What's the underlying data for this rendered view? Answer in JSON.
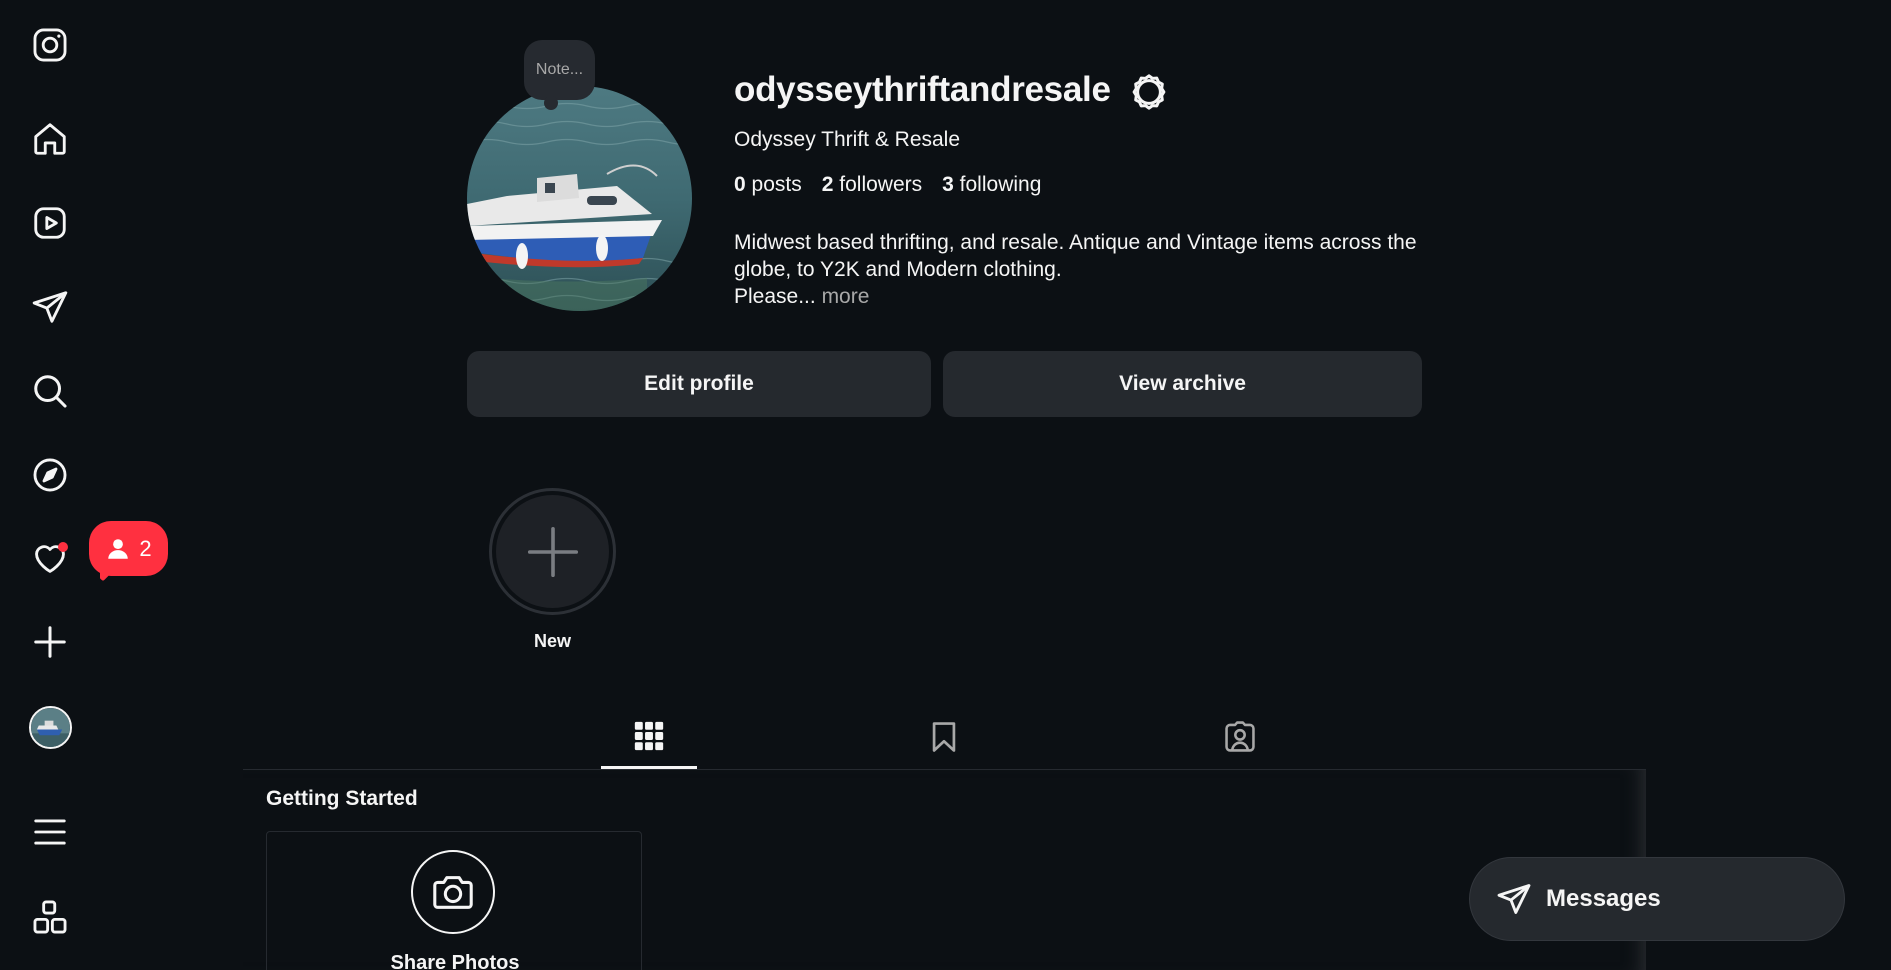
{
  "sidebar": {
    "items": [
      {
        "name": "instagram-logo-icon"
      },
      {
        "name": "home-icon"
      },
      {
        "name": "reels-icon"
      },
      {
        "name": "direct-messages-icon"
      },
      {
        "name": "search-icon"
      },
      {
        "name": "explore-compass-icon"
      },
      {
        "name": "notifications-heart-icon"
      },
      {
        "name": "create-plus-icon"
      },
      {
        "name": "profile-avatar"
      },
      {
        "name": "menu-hamburger-icon"
      },
      {
        "name": "also-from-meta-icon"
      }
    ],
    "notification_badge_count": "2"
  },
  "profile": {
    "note_text": "Note...",
    "username": "odysseythriftandresale",
    "full_name": "Odyssey Thrift & Resale",
    "stats": {
      "posts_count": "0",
      "posts_label": "posts",
      "followers_count": "2",
      "followers_label": "followers",
      "following_count": "3",
      "following_label": "following"
    },
    "bio_line1": "Midwest based thrifting, and resale. Antique and Vintage items across the",
    "bio_line2": "globe, to Y2K and Modern clothing.",
    "bio_line3": "Please...",
    "bio_more": "more",
    "edit_profile_label": "Edit profile",
    "view_archive_label": "View archive"
  },
  "highlights": {
    "new_label": "New"
  },
  "tabs": [
    {
      "name": "tab-posts-grid",
      "active": true
    },
    {
      "name": "tab-saved",
      "active": false
    },
    {
      "name": "tab-tagged",
      "active": false
    }
  ],
  "getting_started": {
    "title": "Getting Started",
    "card_label": "Share Photos"
  },
  "messages": {
    "label": "Messages"
  },
  "colors": {
    "background": "#0c1014",
    "button": "#25292e",
    "notification": "#ff3040",
    "text": "#f5f5f5",
    "muted": "#a8a8a8"
  }
}
